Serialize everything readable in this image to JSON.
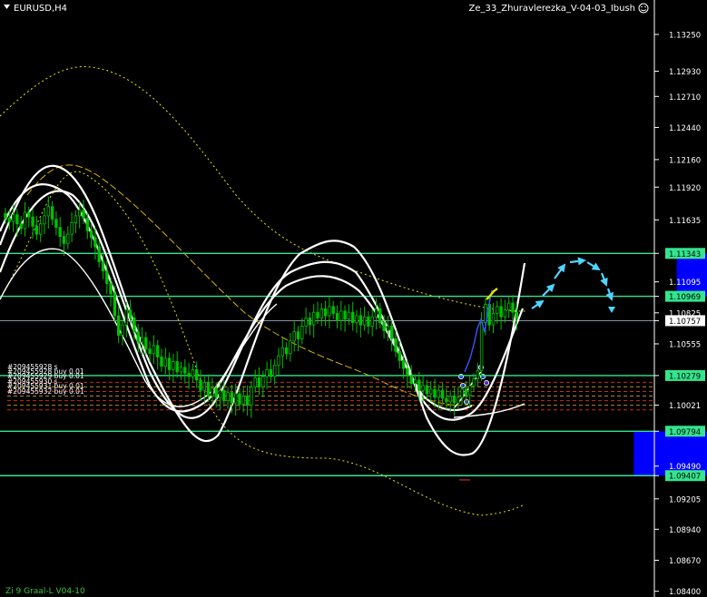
{
  "header": {
    "symbol_label": "EURUSD,H4",
    "indicator_label": "Ze_33_Zhuravlerezka_V-04-03_Ibush",
    "footer_label": "Zi 9 Graal-L V04-10"
  },
  "colors": {
    "background": "#000000",
    "candles": "#00c000",
    "band": "#ffffff",
    "level_line": "#33e58e",
    "zone": "#0000ff",
    "arrow": "#4fd6ff",
    "ma_dotted": "#e6e600",
    "order_line": "#cc2b1b"
  },
  "chart_data": {
    "type": "candlestick",
    "instrument": "EURUSD",
    "timeframe": "H4",
    "y_range": [
      1.0835,
      1.1355
    ],
    "y_ticks": [
      "1.13250",
      "1.12930",
      "1.12710",
      "1.12440",
      "1.12160",
      "1.11920",
      "1.11635",
      "1.11343",
      "1.11095",
      "1.10969",
      "1.10825",
      "1.10757",
      "1.10555",
      "1.10279",
      "1.10021",
      "1.09794",
      "1.09490",
      "1.09407",
      "1.09205",
      "1.08940",
      "1.08670",
      "1.08400"
    ],
    "tick_values": [
      1.1325,
      1.1293,
      1.1271,
      1.1244,
      1.1216,
      1.1192,
      1.11635,
      1.11343,
      1.11095,
      1.10969,
      1.10825,
      1.10757,
      1.10555,
      1.10279,
      1.10021,
      1.09794,
      1.0949,
      1.09407,
      1.09205,
      1.0894,
      1.0867,
      1.084
    ],
    "highlighted_ticks": [
      "1.11343",
      "1.10969",
      "1.10757",
      "1.10279",
      "1.09794",
      "1.09407"
    ],
    "current_price": 1.10757,
    "horizontal_levels": [
      1.11343,
      1.10969,
      1.10279,
      1.09794,
      1.09407
    ],
    "zones": [
      {
        "from_bar": 172,
        "to_bar": 272,
        "low": 1.10969,
        "high": 1.11343
      },
      {
        "from_bar": 161,
        "to_bar": 272,
        "low": 1.09407,
        "high": 1.09794
      }
    ],
    "order_labels": [
      "#209455928 s",
      "#209455928 buy 0.01",
      "#209455929 buy 0.01",
      "#209455930 s",
      "#209455931 buy 0.01",
      "#209455932 buy 0.01"
    ],
    "order_levels": [
      1.1022,
      1.1018,
      1.1014,
      1.101,
      1.1006,
      1.1002,
      1.0998
    ],
    "close_series": [
      1.1165,
      1.1162,
      1.1168,
      1.116,
      1.1156,
      1.117,
      1.1166,
      1.1158,
      1.1151,
      1.116,
      1.1167,
      1.1175,
      1.1164,
      1.1157,
      1.1149,
      1.1143,
      1.1151,
      1.1161,
      1.1167,
      1.1172,
      1.1165,
      1.1154,
      1.1148,
      1.114,
      1.1127,
      1.1119,
      1.1108,
      1.1099,
      1.108,
      1.1063,
      1.1072,
      1.1085,
      1.1078,
      1.1066,
      1.1057,
      1.1061,
      1.1051,
      1.1047,
      1.1054,
      1.1044,
      1.1036,
      1.1043,
      1.1033,
      1.104,
      1.1031,
      1.1035,
      1.103,
      1.1027,
      1.1033,
      1.1024,
      1.1015,
      1.1022,
      1.101,
      1.1017,
      1.1009,
      1.1015,
      1.1006,
      1.1013,
      1.1004,
      1.1012,
      1.1003,
      1.101,
      1.1002,
      1.1018,
      1.1026,
      1.1018,
      1.1027,
      1.1033,
      1.1027,
      1.1037,
      1.1045,
      1.1052,
      1.1047,
      1.1058,
      1.1066,
      1.106,
      1.1071,
      1.1078,
      1.1072,
      1.1083,
      1.1078,
      1.1086,
      1.108,
      1.1088,
      1.1082,
      1.1076,
      1.1084,
      1.1077,
      1.1083,
      1.1074,
      1.108,
      1.1072,
      1.1079,
      1.1071,
      1.1079,
      1.1086,
      1.1074,
      1.1067,
      1.1071,
      1.106,
      1.1049,
      1.1041,
      1.1034,
      1.1028,
      1.1021,
      1.1024,
      1.1015,
      1.1019,
      1.1012,
      1.1016,
      1.1009,
      1.1015,
      1.1008,
      1.1005,
      1.101,
      1.1004,
      1.1009,
      1.1016,
      1.1011,
      1.1019,
      1.1025,
      1.1032,
      1.1074,
      1.109,
      1.1072,
      1.1082,
      1.1088,
      1.1079,
      1.1085,
      1.1091,
      1.1083,
      1.1078
    ]
  }
}
